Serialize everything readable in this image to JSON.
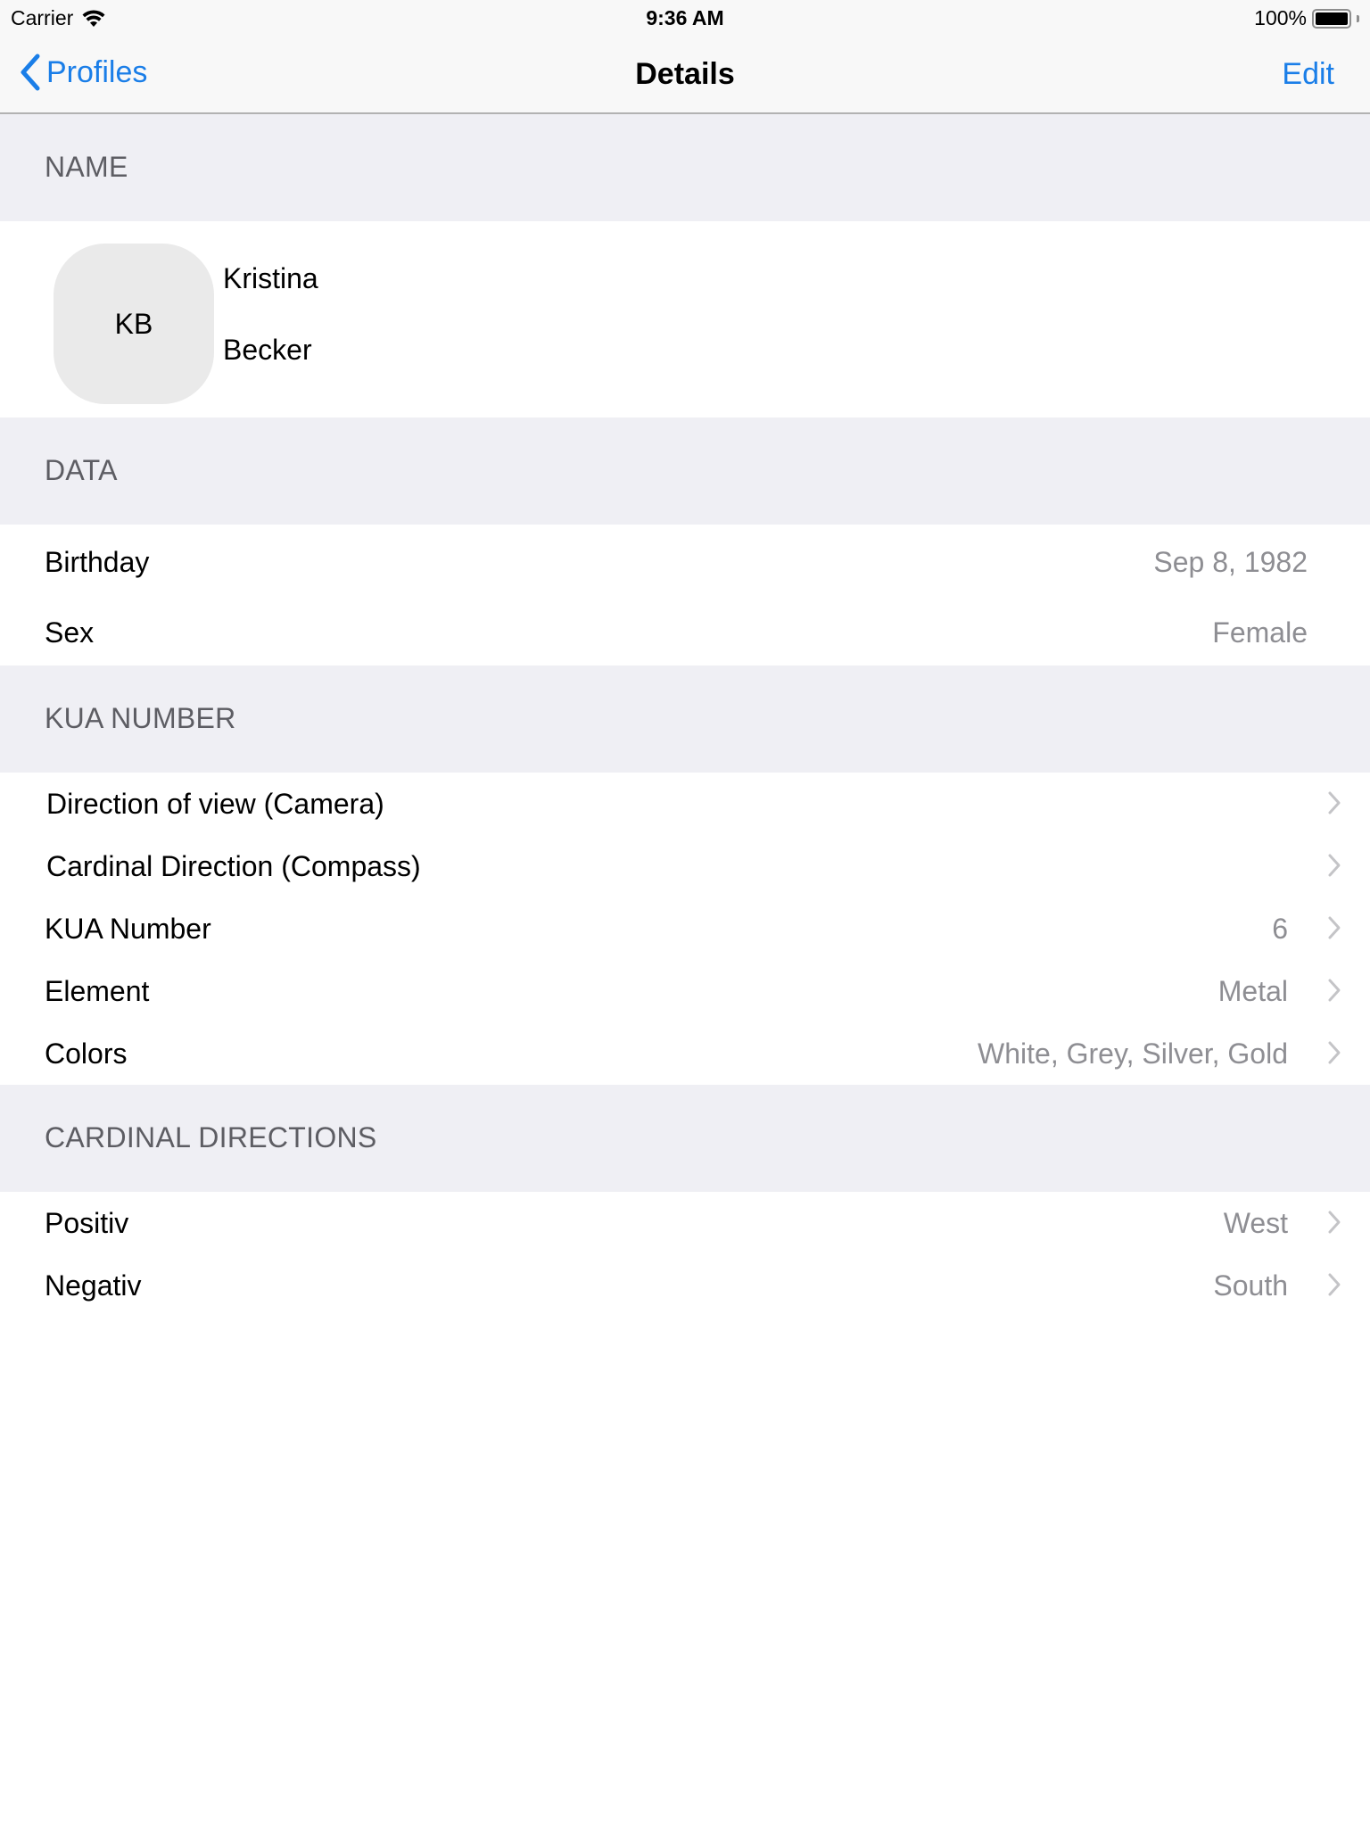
{
  "status_bar": {
    "carrier": "Carrier",
    "time": "9:36 AM",
    "battery": "100%",
    "battery_level": 1.0
  },
  "nav": {
    "back_label": "Profiles",
    "title": "Details",
    "edit_label": "Edit"
  },
  "colors": {
    "accent": "#1a7ee8",
    "section_bg": "#efeff4",
    "secondary_text": "#8e8e93"
  },
  "sections": {
    "name": {
      "header": "NAME",
      "initials": "KB",
      "first_name": "Kristina",
      "last_name": "Becker"
    },
    "data": {
      "header": "DATA",
      "rows": [
        {
          "label": "Birthday",
          "value": "Sep 8, 1982"
        },
        {
          "label": "Sex",
          "value": "Female"
        }
      ]
    },
    "kua": {
      "header": "KUA NUMBER",
      "rows": [
        {
          "label": "Direction of view (Camera)",
          "value": ""
        },
        {
          "label": "Cardinal Direction (Compass)",
          "value": ""
        },
        {
          "label": "KUA Number",
          "value": "6"
        },
        {
          "label": "Element",
          "value": "Metal"
        },
        {
          "label": "Colors",
          "value": "White, Grey, Silver, Gold"
        }
      ]
    },
    "cardinal": {
      "header": "CARDINAL DIRECTIONS",
      "rows": [
        {
          "label": "Positiv",
          "value": "West"
        },
        {
          "label": "Negativ",
          "value": "South"
        }
      ]
    }
  }
}
